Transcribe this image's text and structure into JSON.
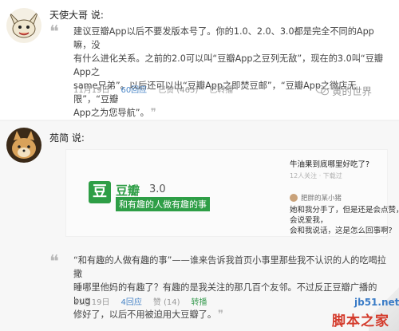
{
  "post1": {
    "username": "天使大哥 说:",
    "quote_lines": [
      "建议豆瓣App以后不要发版本号了。你的1.0、2.0、3.0都是完全不同的App嘛，没",
      "有什么进化关系。之前的2.0可以叫“豆瓣App之豆列无敌”，现在的3.0叫“豆瓣App之",
      "same兄弟”。以后还可以出“豆瓣App之即焚豆邮”，“豆瓣App之微店无限”，“豆瓣",
      "App之为您导航”。"
    ],
    "end_quote": "❞",
    "date": "11月19日",
    "replies": "60回应",
    "likes": "已赞 (465)",
    "reposts": "已转播"
  },
  "watermark_wechat": "黄的世界",
  "post2": {
    "username": "苑简 说:",
    "card": {
      "logo_char": "豆",
      "app_name": "豆瓣",
      "version": "3.0",
      "slogan": "和有趣的人做有趣的事",
      "mini_question": "牛油果到底哪里好吃了?",
      "mini_meta": "12人关注 · 下载过",
      "mini_user": "肥胖的某小猪",
      "mini_answer_lines": [
        "她和我分手了，但是还是会点赞，会说爱我，",
        "会和我说话，这是怎么回事啊?"
      ]
    },
    "quote_lines": [
      "“和有趣的人做有趣的事”——谁来告诉我首页小事里那些我不认识的人的吃喝拉撒",
      "睡哪里他妈的有趣了？有趣的是我关注的那几百个友邻。不过反正豆瓣广播的bug",
      "修好了，以后不用被迫用大豆瓣了。"
    ],
    "end_quote": "❞",
    "date": "11月19日",
    "replies": "4回应",
    "likes": "赞 (14)",
    "reposts": "转播"
  },
  "watermark_site": "jb51.net",
  "watermark_site_cn": "脚本之家",
  "colors": {
    "green": "#3c9d53",
    "blue": "#4a86c7",
    "brand_green": "#2e9e46"
  }
}
